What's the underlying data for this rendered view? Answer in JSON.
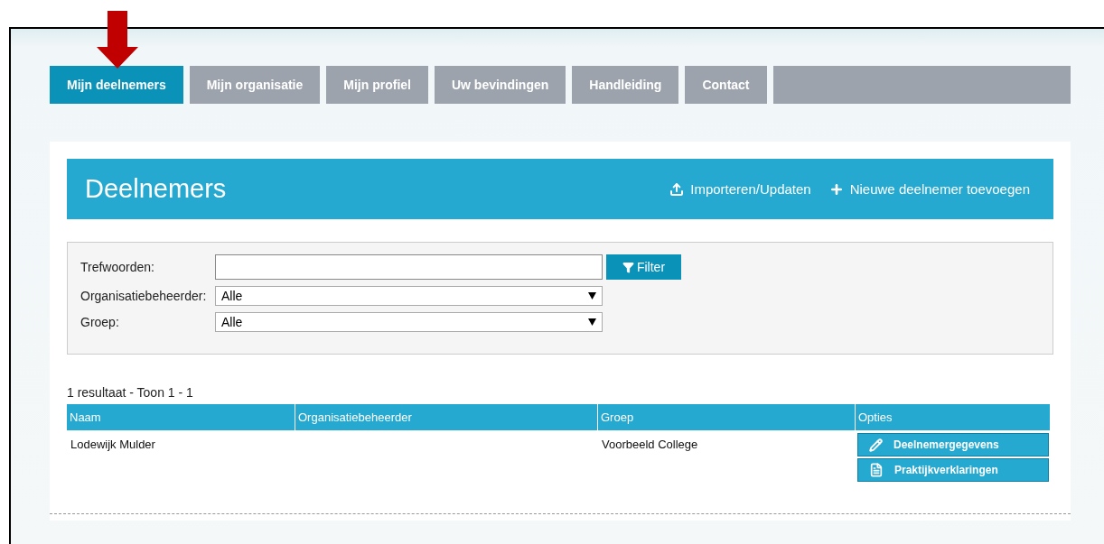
{
  "tabs": [
    {
      "label": "Mijn deelnemers",
      "selected": true
    },
    {
      "label": "Mijn organisatie",
      "selected": false
    },
    {
      "label": "Mijn profiel",
      "selected": false
    },
    {
      "label": "Uw bevindingen",
      "selected": false
    },
    {
      "label": "Handleiding",
      "selected": false
    },
    {
      "label": "Contact",
      "selected": false
    }
  ],
  "header": {
    "title": "Deelnemers",
    "actions": [
      {
        "label": "Importeren/Updaten",
        "kind": "upload"
      },
      {
        "label": "Nieuwe deelnemer toevoegen",
        "kind": "add"
      }
    ]
  },
  "filter": {
    "fields": [
      {
        "label": "Trefwoorden:",
        "kind": "text"
      },
      {
        "label": "Organisatiebeheerder:",
        "kind": "select",
        "value": "Alle"
      },
      {
        "label": "Groep:",
        "kind": "select",
        "value": "Alle"
      }
    ],
    "button": "Filter"
  },
  "results": "1 resultaat - Toon 1 - 1",
  "table": {
    "columns": [
      "Naam",
      "Organisatiebeheerder",
      "Groep",
      "Opties"
    ],
    "rows": [
      {
        "cells": [
          "Lodewijk Mulder",
          "",
          "Voorbeeld College"
        ],
        "options": [
          {
            "label": "Deelnemergegevens",
            "kind": "edit"
          },
          {
            "label": "Praktijkverklaringen",
            "kind": "document"
          }
        ]
      }
    ]
  }
}
